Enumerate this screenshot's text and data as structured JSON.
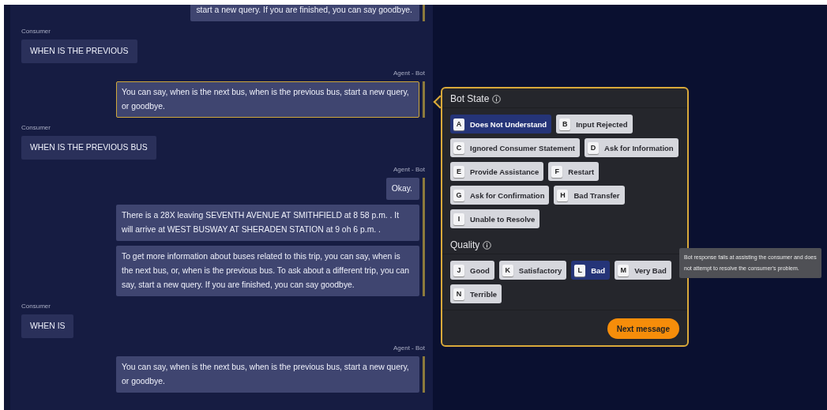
{
  "conversation": [
    {
      "kind": "bot",
      "messages": [
        {
          "text": "start a new query. If you are finished, you can say goodbye.",
          "selected": false
        }
      ]
    },
    {
      "speaker": "Consumer",
      "kind": "consumer",
      "messages": [
        {
          "text": "WHEN IS THE PREVIOUS",
          "selected": false
        }
      ]
    },
    {
      "speaker": "Agent - Bot",
      "kind": "bot",
      "messages": [
        {
          "text": " You can say, when is the next bus, when is the previous bus, start a new query, or goodbye.",
          "selected": true
        }
      ]
    },
    {
      "speaker": "Consumer",
      "kind": "consumer",
      "messages": [
        {
          "text": "WHEN IS THE PREVIOUS BUS",
          "selected": false
        }
      ]
    },
    {
      "speaker": "Agent - Bot",
      "kind": "bot",
      "messages": [
        {
          "text": "Okay.",
          "selected": false
        },
        {
          "text": " There is a 28X leaving SEVENTH AVENUE AT SMITHFIELD at 8 58 p.m. . It will arrive at WEST BUSWAY AT SHERADEN STATION at 9 oh 6 p.m. .",
          "selected": false
        },
        {
          "text": " To get more information about buses related to this trip, you can say, when is the next bus, or, when is the previous bus. To ask about a different trip, you can say, start a new query. If you are finished, you can say goodbye.",
          "selected": false
        }
      ]
    },
    {
      "speaker": "Consumer",
      "kind": "consumer",
      "messages": [
        {
          "text": "WHEN IS",
          "selected": false
        }
      ]
    },
    {
      "speaker": "Agent - Bot",
      "kind": "bot",
      "messages": [
        {
          "text": " You can say, when is the next bus, when is the previous bus, start a new query, or goodbye.",
          "selected": false
        }
      ]
    }
  ],
  "annotation": {
    "sections": [
      {
        "title": "Bot State",
        "options": [
          {
            "key": "A",
            "label": "Does Not Understand",
            "selected": true
          },
          {
            "key": "B",
            "label": "Input Rejected",
            "selected": false
          },
          {
            "key": "C",
            "label": "Ignored Consumer Statement",
            "selected": false
          },
          {
            "key": "D",
            "label": "Ask for Information",
            "selected": false
          },
          {
            "key": "E",
            "label": "Provide Assistance",
            "selected": false
          },
          {
            "key": "F",
            "label": "Restart",
            "selected": false
          },
          {
            "key": "G",
            "label": "Ask for Confirmation",
            "selected": false
          },
          {
            "key": "H",
            "label": "Bad Transfer",
            "selected": false
          },
          {
            "key": "I",
            "label": "Unable to Resolve",
            "selected": false
          }
        ]
      },
      {
        "title": "Quality",
        "options": [
          {
            "key": "J",
            "label": "Good",
            "selected": false
          },
          {
            "key": "K",
            "label": "Satisfactory",
            "selected": false
          },
          {
            "key": "L",
            "label": "Bad",
            "selected": true
          },
          {
            "key": "M",
            "label": "Very Bad",
            "selected": false
          },
          {
            "key": "N",
            "label": "Terrible",
            "selected": false
          }
        ]
      }
    ],
    "next_button": "Next message",
    "tooltip": "Bot response fails at assisting the consumer and does not attempt to resolve the consumer's problem."
  }
}
